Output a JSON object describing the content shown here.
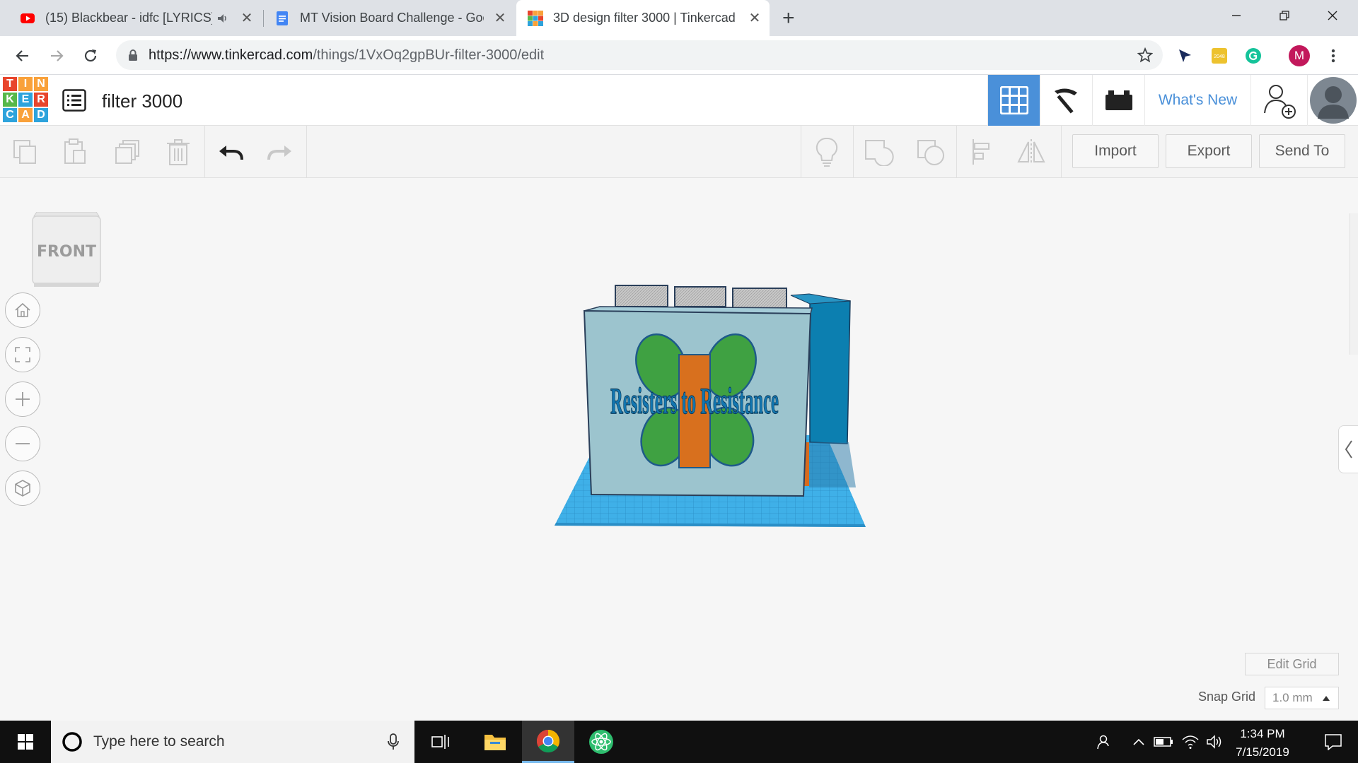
{
  "browser": {
    "tabs": [
      {
        "title": "(15) Blackbear - idfc [LYRICS]",
        "favicon": "youtube-icon"
      },
      {
        "title": "MT Vision Board Challenge - Goo",
        "favicon": "google-docs-icon"
      },
      {
        "title": "3D design filter 3000 | Tinkercad",
        "favicon": "tinkercad-icon",
        "active": true
      }
    ],
    "new_tab": "+",
    "url_domain": "https://www.tinkercad.com",
    "url_path": "/things/1VxOq2gpBUr-filter-3000/edit",
    "profile_letter": "M"
  },
  "tinkercad": {
    "logo_letters": [
      "T",
      "I",
      "N",
      "K",
      "E",
      "R",
      "C",
      "A",
      "D"
    ],
    "logo_colors": [
      "#e8452c",
      "#f9a13a",
      "#f9a13a",
      "#57b849",
      "#2ea3dc",
      "#e8452c",
      "#2ea3dc",
      "#f9a13a",
      "#2ea3dc"
    ],
    "design_title": "filter 3000",
    "whats_new": "What's New",
    "import_label": "Import",
    "export_label": "Export",
    "send_to_label": "Send To",
    "view_cube_label": "FRONT",
    "model_text": "Resisters to Resistance",
    "edit_grid_label": "Edit Grid",
    "snap_grid_label": "Snap Grid",
    "snap_grid_value": "1.0 mm",
    "accent": "#4a90d9"
  },
  "taskbar": {
    "search_placeholder": "Type here to search",
    "time": "1:34 PM",
    "date": "7/15/2019"
  }
}
